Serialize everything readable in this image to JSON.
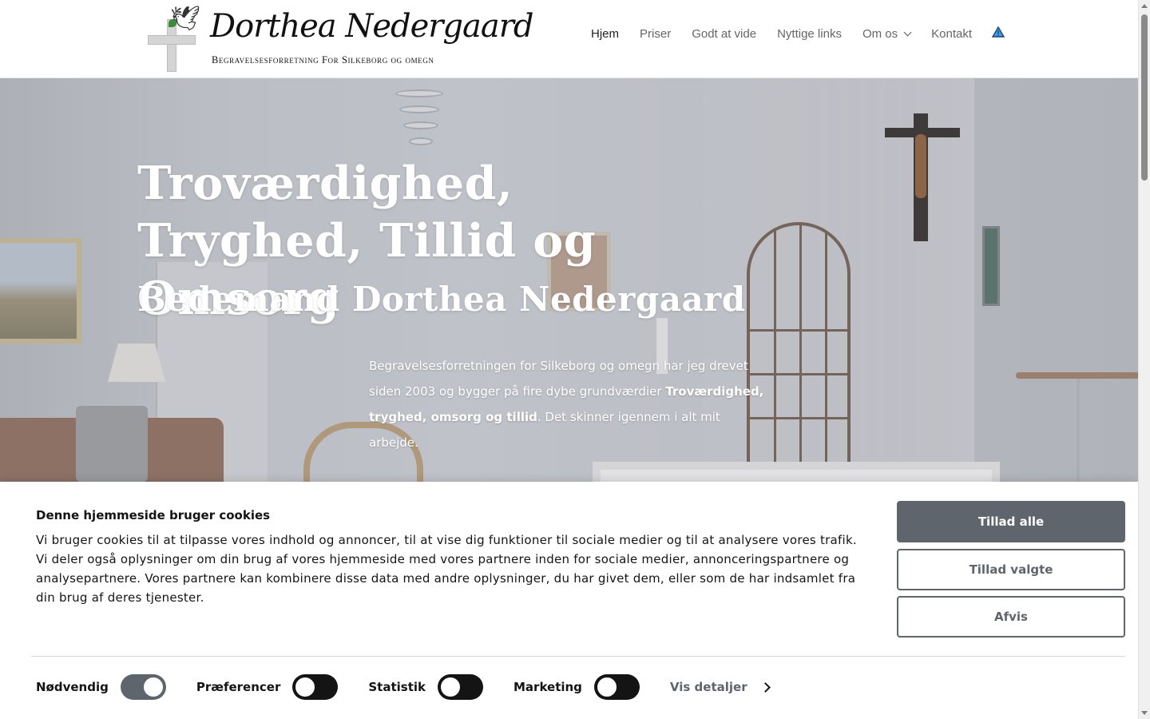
{
  "logo": {
    "name": "Dorthea Nedergaard",
    "tagline": "Begravelsesforretning For Silkeborg og omegn"
  },
  "nav": {
    "items": [
      {
        "label": "Hjem",
        "active": true
      },
      {
        "label": "Priser"
      },
      {
        "label": "Godt at vide"
      },
      {
        "label": "Nyttige links"
      },
      {
        "label": "Om os",
        "dropdown": true
      },
      {
        "label": "Kontakt"
      }
    ],
    "accessibility_icon": "warning-triangle-icon"
  },
  "hero": {
    "title": "Troværdighed, Tryghed, Tillid og Omsorg",
    "subtitle": "Bedemand Dorthea Nedergaard",
    "text_part1": "Begravelsesforretningen for Silkeborg og omegn har jeg drevet siden 2003 og bygger på fire dybe grundværdier ",
    "text_bold": "Troværdighed, tryghed, omsorg og tillid",
    "text_part2": ". Det skinner igennem i alt mit arbejde."
  },
  "cookie": {
    "title": "Denne hjemmeside bruger cookies",
    "text": "Vi bruger cookies til at tilpasse vores indhold og annoncer, til at vise dig funktioner til sociale medier og til at analysere vores trafik. Vi deler også oplysninger om din brug af vores hjemmeside med vores partnere inden for sociale medier, annonceringspartnere og analysepartnere. Vores partnere kan kombinere disse data med andre oplysninger, du har givet dem, eller som de har indsamlet fra din brug af deres tjenester.",
    "buttons": {
      "allow_all": "Tillad alle",
      "allow_selected": "Tillad valgte",
      "decline": "Afvis"
    },
    "toggles": [
      {
        "label": "Nødvendig",
        "on": true
      },
      {
        "label": "Præferencer",
        "on": false
      },
      {
        "label": "Statistik",
        "on": false
      },
      {
        "label": "Marketing",
        "on": false
      }
    ],
    "details_label": "Vis detaljer"
  },
  "colors": {
    "button_gray": "#5f656d",
    "text_dark": "#141414"
  }
}
